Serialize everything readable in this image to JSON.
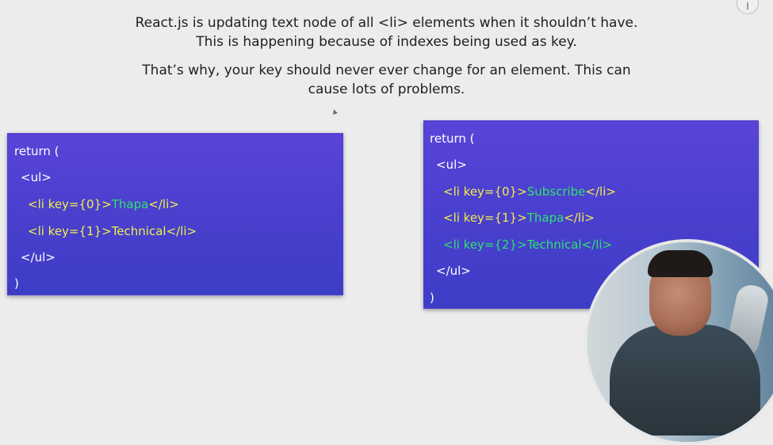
{
  "captions": {
    "line1": "React.js is updating text node of all <li> elements when it shouldn’t have.",
    "line2": "This is happening because of indexes being used as key.",
    "line3": "That’s why, your key should never ever change for an element. This can",
    "line4": "cause lots of problems."
  },
  "code_left": {
    "return_open": "return (",
    "ul_open": "<ul>",
    "li1_open": "<li key={0}>",
    "li1_text": "Thapa",
    "li1_close": "</li>",
    "li2_open": "<li key={1}>",
    "li2_text": "Technical",
    "li2_close": "</li>",
    "ul_close": "</ul>",
    "paren_close": ")"
  },
  "code_right": {
    "return_open": "return (",
    "ul_open": "<ul>",
    "li1_open": "<li key={0}>",
    "li1_text": "Subscribe",
    "li1_close": "</li>",
    "li2_open": "<li key={1}>",
    "li2_text": "Thapa",
    "li2_close": "</li>",
    "li3_open": "<li key={2}>",
    "li3_text": "Technical",
    "li3_close": "</li>",
    "ul_close": "</ul>",
    "paren_close": ")"
  },
  "colors": {
    "code_background": "#4b40cf",
    "tag_color": "#f3ee4a",
    "highlight_green": "#2ee36b",
    "page_background": "#ececec"
  }
}
